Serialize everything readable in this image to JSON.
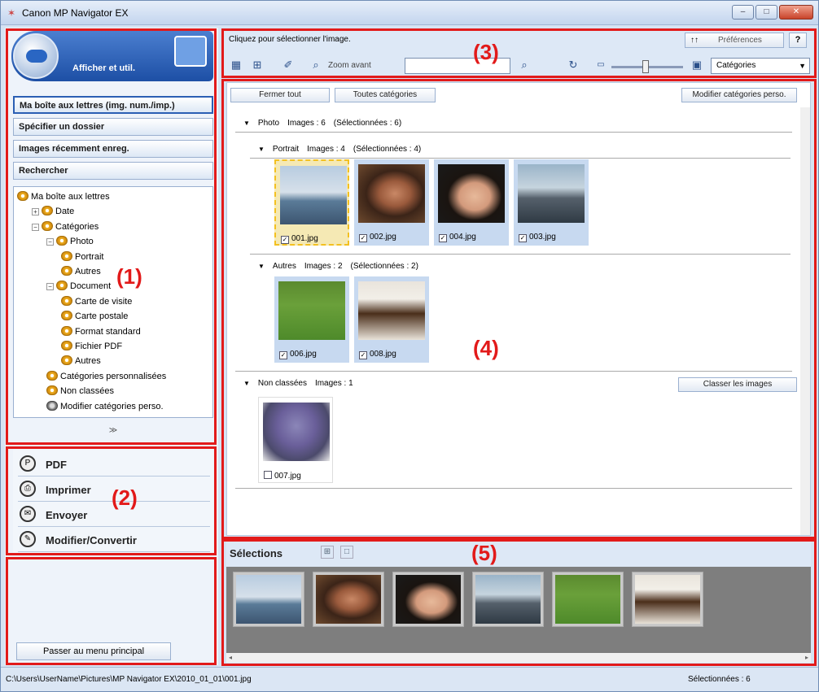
{
  "window": {
    "title": "Canon MP Navigator EX",
    "min": "–",
    "max": "□",
    "close": "✕"
  },
  "left": {
    "mode_label": "Afficher et util.",
    "nav": [
      "Ma boîte aux lettres (img. num./imp.)",
      "Spécifier un dossier",
      "Images récemment enreg.",
      "Rechercher"
    ],
    "tree": [
      {
        "label": "Ma boîte aux lettres",
        "level": 0,
        "exp": ""
      },
      {
        "label": "Date",
        "level": 1,
        "exp": "+"
      },
      {
        "label": "Catégories",
        "level": 1,
        "exp": "−"
      },
      {
        "label": "Photo",
        "level": 2,
        "exp": "−"
      },
      {
        "label": "Portrait",
        "level": 3,
        "exp": "",
        "bold": true
      },
      {
        "label": "Autres",
        "level": 3,
        "exp": ""
      },
      {
        "label": "Document",
        "level": 2,
        "exp": "−"
      },
      {
        "label": "Carte de visite",
        "level": 3,
        "exp": ""
      },
      {
        "label": "Carte postale",
        "level": 3,
        "exp": ""
      },
      {
        "label": "Format standard",
        "level": 3,
        "exp": ""
      },
      {
        "label": "Fichier PDF",
        "level": 3,
        "exp": ""
      },
      {
        "label": "Autres",
        "level": 3,
        "exp": ""
      },
      {
        "label": "Catégories personnalisées",
        "level": 2,
        "exp": ""
      },
      {
        "label": "Non classées",
        "level": 2,
        "exp": ""
      },
      {
        "label": "Modifier catégories perso.",
        "level": 2,
        "exp": "",
        "icon": "mod"
      }
    ],
    "collapse": "≫",
    "tasks": [
      {
        "label": "PDF",
        "icon": "P"
      },
      {
        "label": "Imprimer",
        "icon": "⎙"
      },
      {
        "label": "Envoyer",
        "icon": "✉"
      },
      {
        "label": "Modifier/Convertir",
        "icon": "✎"
      }
    ],
    "main_menu": "Passer au menu principal"
  },
  "annotations": [
    "(1)",
    "(2)",
    "(3)",
    "(4)",
    "(5)"
  ],
  "toolbar": {
    "hint": "Cliquez pour sélectionner l'image.",
    "pref": "Préférences",
    "pref_icon": "↑↑",
    "help": "?",
    "zoom": "Zoom avant",
    "search_value": "",
    "category_select": "Catégories"
  },
  "view": {
    "close_all": "Fermer tout",
    "all_categories": "Toutes catégories",
    "edit_custom": "Modifier catégories perso.",
    "classify": "Classer les images",
    "groups": {
      "photo": {
        "name": "Photo",
        "images": "Images : 6",
        "selected": "(Sélectionnées : 6)"
      },
      "portrait": {
        "name": "Portrait",
        "images": "Images : 4",
        "selected": "(Sélectionnées : 4)"
      },
      "autres": {
        "name": "Autres",
        "images": "Images : 2",
        "selected": "(Sélectionnées : 2)"
      },
      "non": {
        "name": "Non classées",
        "images": "Images : 1"
      }
    },
    "portrait_images": [
      "001.jpg",
      "002.jpg",
      "004.jpg",
      "003.jpg"
    ],
    "autres_images": [
      "006.jpg",
      "008.jpg"
    ],
    "non_images": [
      "007.jpg"
    ]
  },
  "selections": {
    "title": "Sélections"
  },
  "status": {
    "path": "C:\\Users\\UserName\\Pictures\\MP Navigator EX\\2010_01_01\\001.jpg",
    "count": "Sélectionnées : 6"
  }
}
